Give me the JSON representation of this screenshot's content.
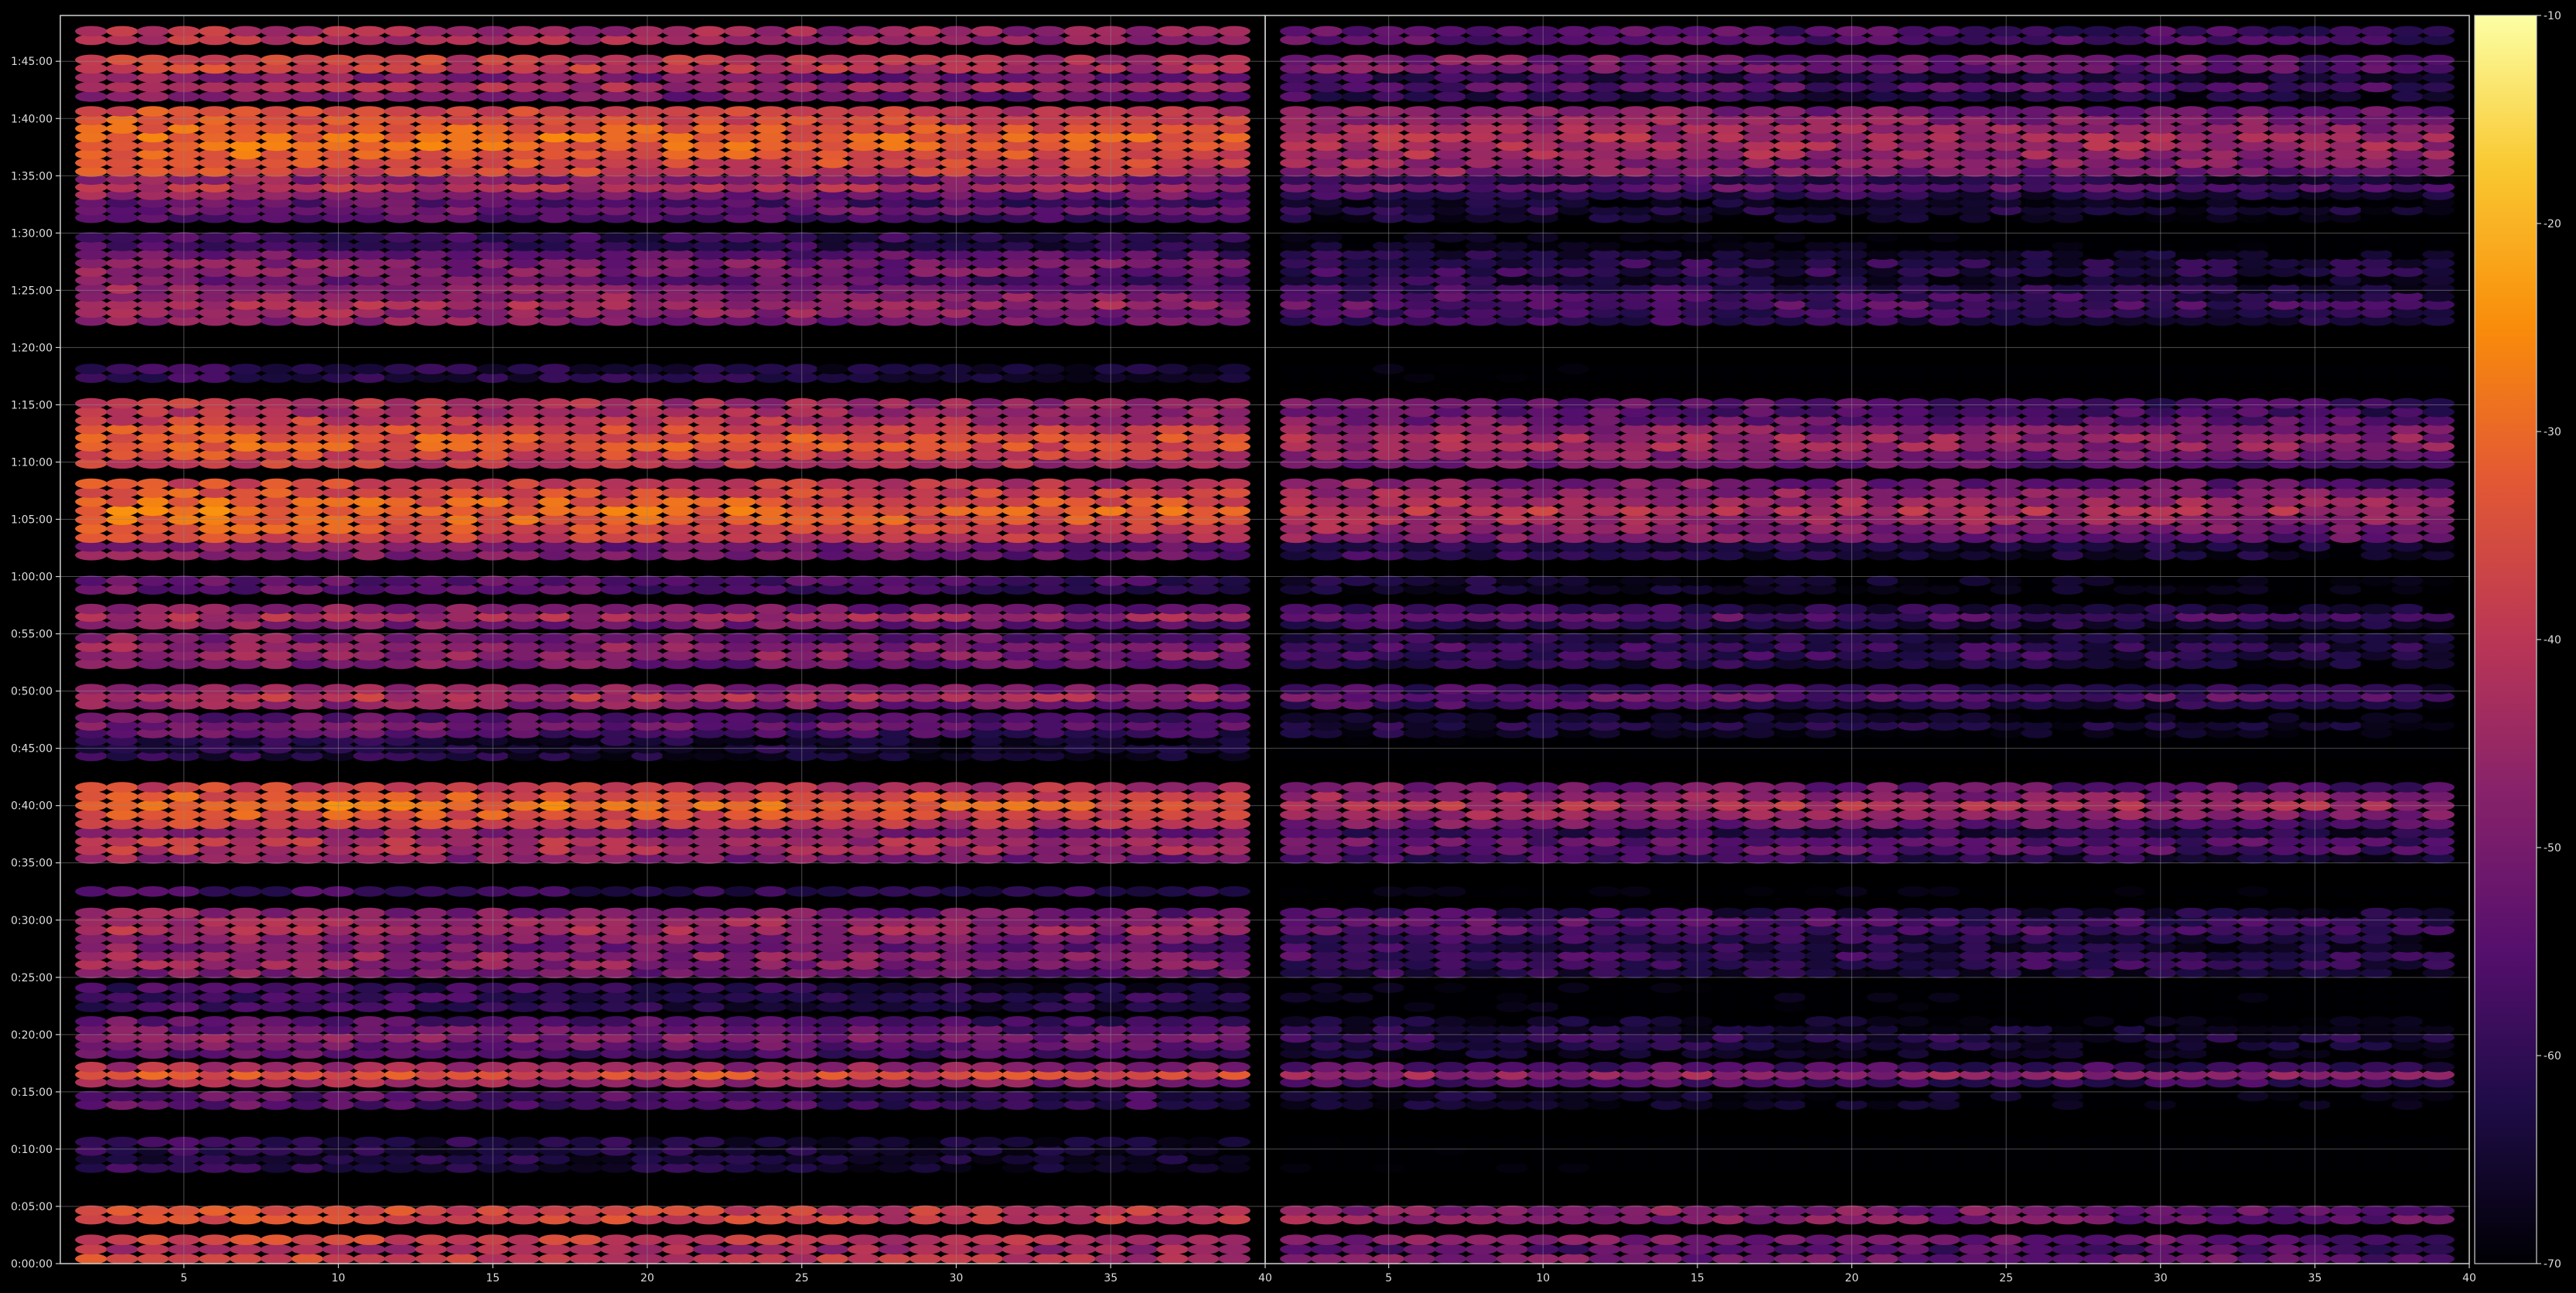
{
  "chart_data": {
    "type": "heatmap",
    "title": "",
    "xlabel": "",
    "ylabel": "",
    "colormap": "inferno",
    "panels": [
      {
        "name": "left",
        "xlim": [
          1,
          40
        ],
        "x_ticks": [
          5,
          10,
          15,
          20,
          25,
          30,
          35,
          40
        ],
        "x_tick_labels": [
          "5",
          "10",
          "15",
          "20",
          "25",
          "30",
          "35",
          "40"
        ],
        "columns": [
          2,
          3,
          4,
          5,
          6,
          7,
          8,
          9,
          10,
          11,
          12,
          13,
          14,
          15,
          16,
          17,
          18,
          19,
          20,
          21,
          22,
          23,
          24,
          25,
          26,
          27,
          28,
          29,
          30,
          31,
          32,
          33,
          34,
          35,
          36,
          37,
          38,
          39
        ],
        "intensity_offset_db": 0
      },
      {
        "name": "right",
        "xlim": [
          1,
          40
        ],
        "x_ticks": [
          5,
          10,
          15,
          20,
          25,
          30,
          35,
          40
        ],
        "x_tick_labels": [
          "5",
          "10",
          "15",
          "20",
          "25",
          "30",
          "35",
          "40"
        ],
        "columns": [
          2,
          3,
          4,
          5,
          6,
          7,
          8,
          9,
          10,
          11,
          12,
          13,
          14,
          15,
          16,
          17,
          18,
          19,
          20,
          21,
          22,
          23,
          24,
          25,
          26,
          27,
          28,
          29,
          30,
          31,
          32,
          33,
          34,
          35,
          36,
          37,
          38,
          39
        ],
        "intensity_offset_db": -12
      }
    ],
    "y_axis": {
      "unit": "minutes",
      "ylim": [
        0,
        109
      ],
      "ticks": [
        0,
        5,
        10,
        15,
        20,
        25,
        30,
        35,
        40,
        45,
        50,
        55,
        60,
        65,
        70,
        75,
        80,
        85,
        90,
        95,
        100,
        105
      ],
      "tick_labels": [
        "0:00:00",
        "0:05:00",
        "0:10:00",
        "0:15:00",
        "0:20:00",
        "0:25:00",
        "0:30:00",
        "0:35:00",
        "0:40:00",
        "0:45:00",
        "0:50:00",
        "0:55:00",
        "1:00:00",
        "1:05:00",
        "1:10:00",
        "1:15:00",
        "1:20:00",
        "1:25:00",
        "1:30:00",
        "1:35:00",
        "1:40:00",
        "1:45:00"
      ]
    },
    "bands": [
      {
        "from": 0,
        "to": 2.5,
        "level_db": -42,
        "edge_db": -32
      },
      {
        "from": 3.5,
        "to": 5,
        "level_db": -28,
        "edge_db": -38
      },
      {
        "from": 8,
        "to": 11,
        "level_db": -62,
        "edge_db": -58
      },
      {
        "from": 13.5,
        "to": 15,
        "level_db": -54,
        "edge_db": -52
      },
      {
        "from": 15.5,
        "to": 17.5,
        "level_db": -33,
        "edge_db": -48
      },
      {
        "from": 18,
        "to": 21.5,
        "level_db": -48,
        "edge_db": -56
      },
      {
        "from": 22,
        "to": 24.5,
        "level_db": -58,
        "edge_db": -58
      },
      {
        "from": 25,
        "to": 28,
        "level_db": -44,
        "edge_db": -50
      },
      {
        "from": 28,
        "to": 31,
        "level_db": -40,
        "edge_db": -50
      },
      {
        "from": 32,
        "to": 33,
        "level_db": -58,
        "edge_db": -56
      },
      {
        "from": 35,
        "to": 38,
        "level_db": -38,
        "edge_db": -50
      },
      {
        "from": 38,
        "to": 42,
        "level_db": -28,
        "edge_db": -42
      },
      {
        "from": 44,
        "to": 46,
        "level_db": -62,
        "edge_db": -60
      },
      {
        "from": 46,
        "to": 48,
        "level_db": -50,
        "edge_db": -54
      },
      {
        "from": 48.5,
        "to": 50.5,
        "level_db": -40,
        "edge_db": -48
      },
      {
        "from": 52,
        "to": 55,
        "level_db": -44,
        "edge_db": -50
      },
      {
        "from": 55.5,
        "to": 57.5,
        "level_db": -42,
        "edge_db": -50
      },
      {
        "from": 58.5,
        "to": 60,
        "level_db": -48,
        "edge_db": -55
      },
      {
        "from": 61.5,
        "to": 63,
        "level_db": -44,
        "edge_db": -50
      },
      {
        "from": 63,
        "to": 68.5,
        "level_db": -28,
        "edge_db": -40
      },
      {
        "from": 69.5,
        "to": 74,
        "level_db": -30,
        "edge_db": -42
      },
      {
        "from": 74,
        "to": 75.5,
        "level_db": -34,
        "edge_db": -44
      },
      {
        "from": 77,
        "to": 78.5,
        "level_db": -62,
        "edge_db": -58
      },
      {
        "from": 82,
        "to": 85.5,
        "level_db": -42,
        "edge_db": -48
      },
      {
        "from": 85.5,
        "to": 88.5,
        "level_db": -46,
        "edge_db": -52
      },
      {
        "from": 88.5,
        "to": 90,
        "level_db": -56,
        "edge_db": -56
      },
      {
        "from": 91,
        "to": 93,
        "level_db": -50,
        "edge_db": -54
      },
      {
        "from": 93,
        "to": 95,
        "level_db": -40,
        "edge_db": -50
      },
      {
        "from": 95,
        "to": 101,
        "level_db": -28,
        "edge_db": -38
      },
      {
        "from": 101.5,
        "to": 104,
        "level_db": -42,
        "edge_db": -50
      },
      {
        "from": 104,
        "to": 105.5,
        "level_db": -30,
        "edge_db": -40
      },
      {
        "from": 106.5,
        "to": 108,
        "level_db": -36,
        "edge_db": -44
      }
    ],
    "colorbar": {
      "min": -70,
      "max": -10,
      "ticks": [
        -10,
        -20,
        -30,
        -40,
        -50,
        -60,
        -70
      ],
      "tick_labels": [
        "-10",
        "-20",
        "-30",
        "-40",
        "-50",
        "-60",
        "-70"
      ]
    },
    "grid": true
  }
}
